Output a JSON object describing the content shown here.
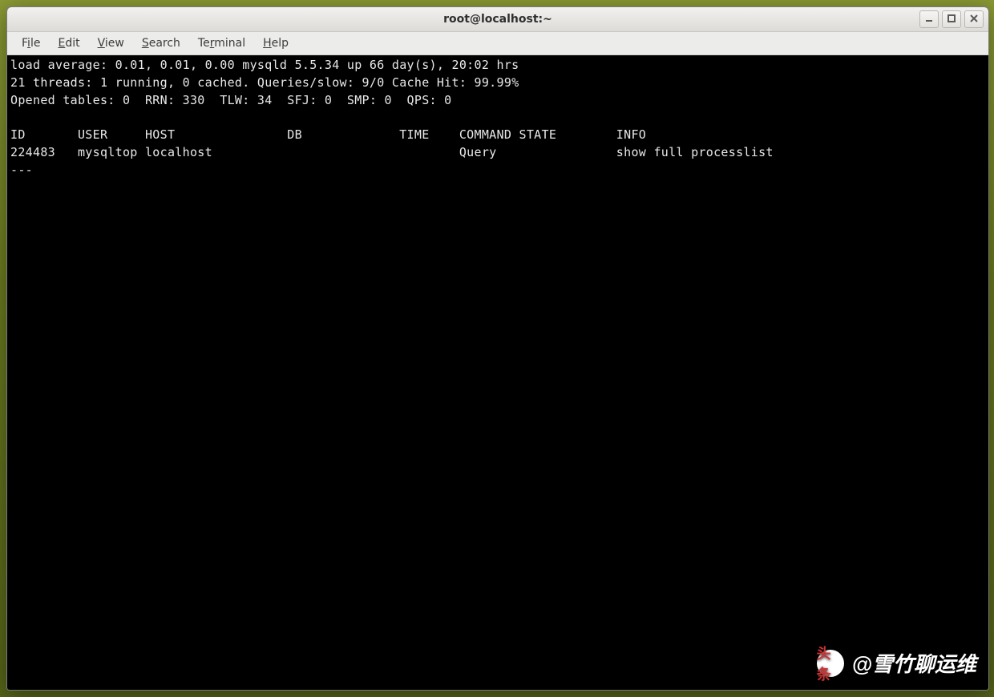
{
  "window": {
    "title": "root@localhost:~"
  },
  "menubar": {
    "file": {
      "pre": "F",
      "u": "i",
      "post": "le"
    },
    "edit": {
      "pre": "",
      "u": "E",
      "post": "dit"
    },
    "view": {
      "pre": "",
      "u": "V",
      "post": "iew"
    },
    "search": {
      "pre": "",
      "u": "S",
      "post": "earch"
    },
    "terminal": {
      "pre": "Te",
      "u": "r",
      "post": "minal"
    },
    "help": {
      "pre": "",
      "u": "H",
      "post": "elp"
    }
  },
  "terminal": {
    "line1": "load average: 0.01, 0.01, 0.00 mysqld 5.5.34 up 66 day(s), 20:02 hrs",
    "line2": "21 threads: 1 running, 0 cached. Queries/slow: 9/0 Cache Hit: 99.99%",
    "line3": "Opened tables: 0  RRN: 330  TLW: 34  SFJ: 0  SMP: 0  QPS: 0",
    "line4": "",
    "line5": "ID       USER     HOST               DB             TIME    COMMAND STATE        INFO",
    "line6": "224483   mysqltop localhost                                 Query                show full processlist",
    "line7": "---"
  },
  "watermark": {
    "logo": "头条",
    "text": "@雪竹聊运维"
  }
}
